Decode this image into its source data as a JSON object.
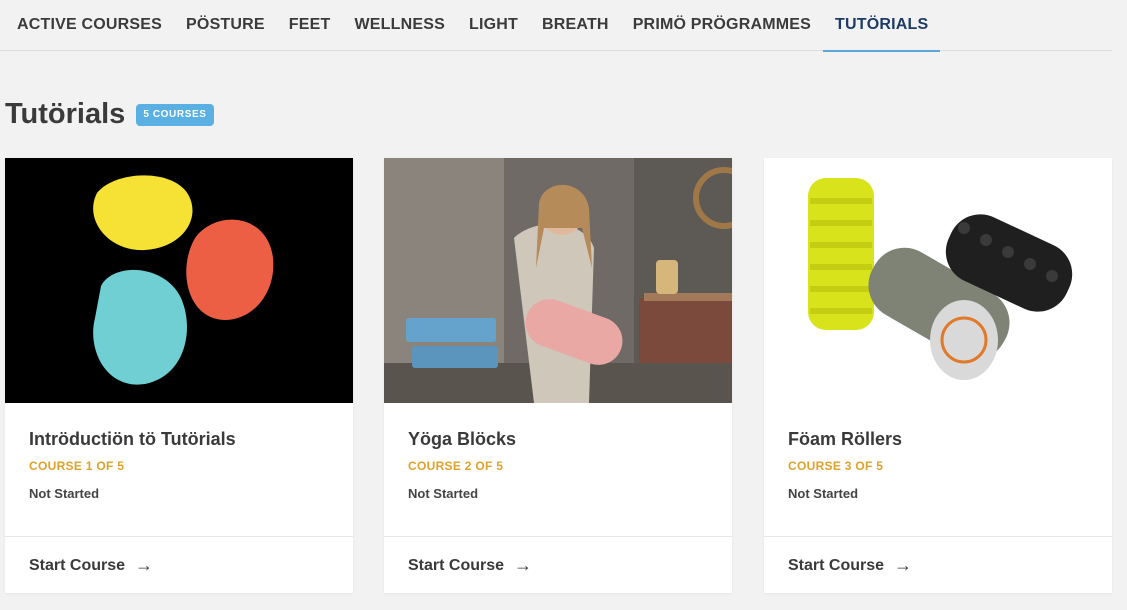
{
  "nav": {
    "items": [
      {
        "label": "ACTIVE COURSES"
      },
      {
        "label": "PÖSTURE"
      },
      {
        "label": "FEET"
      },
      {
        "label": "WELLNESS"
      },
      {
        "label": "LIGHT"
      },
      {
        "label": "BREATH"
      },
      {
        "label": "PRIMÖ PRÖGRAMMES"
      },
      {
        "label": "TUTÖRIALS"
      }
    ],
    "active": "TUTÖRIALS"
  },
  "section": {
    "title": "Tutörials",
    "badge": "5 COURSES"
  },
  "courses": [
    {
      "title": "Intröductiön tö Tutörials",
      "count": "COURSE 1 OF 5",
      "status": "Not Started",
      "action": "Start Course",
      "image": "colorful-pebbles-logo"
    },
    {
      "title": "Yöga Blöcks",
      "count": "COURSE 2 OF 5",
      "status": "Not Started",
      "action": "Start Course",
      "image": "woman-holding-yoga-mat-and-blocks"
    },
    {
      "title": "Föam Röllers",
      "count": "COURSE 3 OF 5",
      "status": "Not Started",
      "action": "Start Course",
      "image": "foam-rollers-product-photo"
    }
  ],
  "colors": {
    "accent": "#5ab0e2",
    "course_count": "#e0a12b",
    "active_nav": "#1d3b66"
  }
}
